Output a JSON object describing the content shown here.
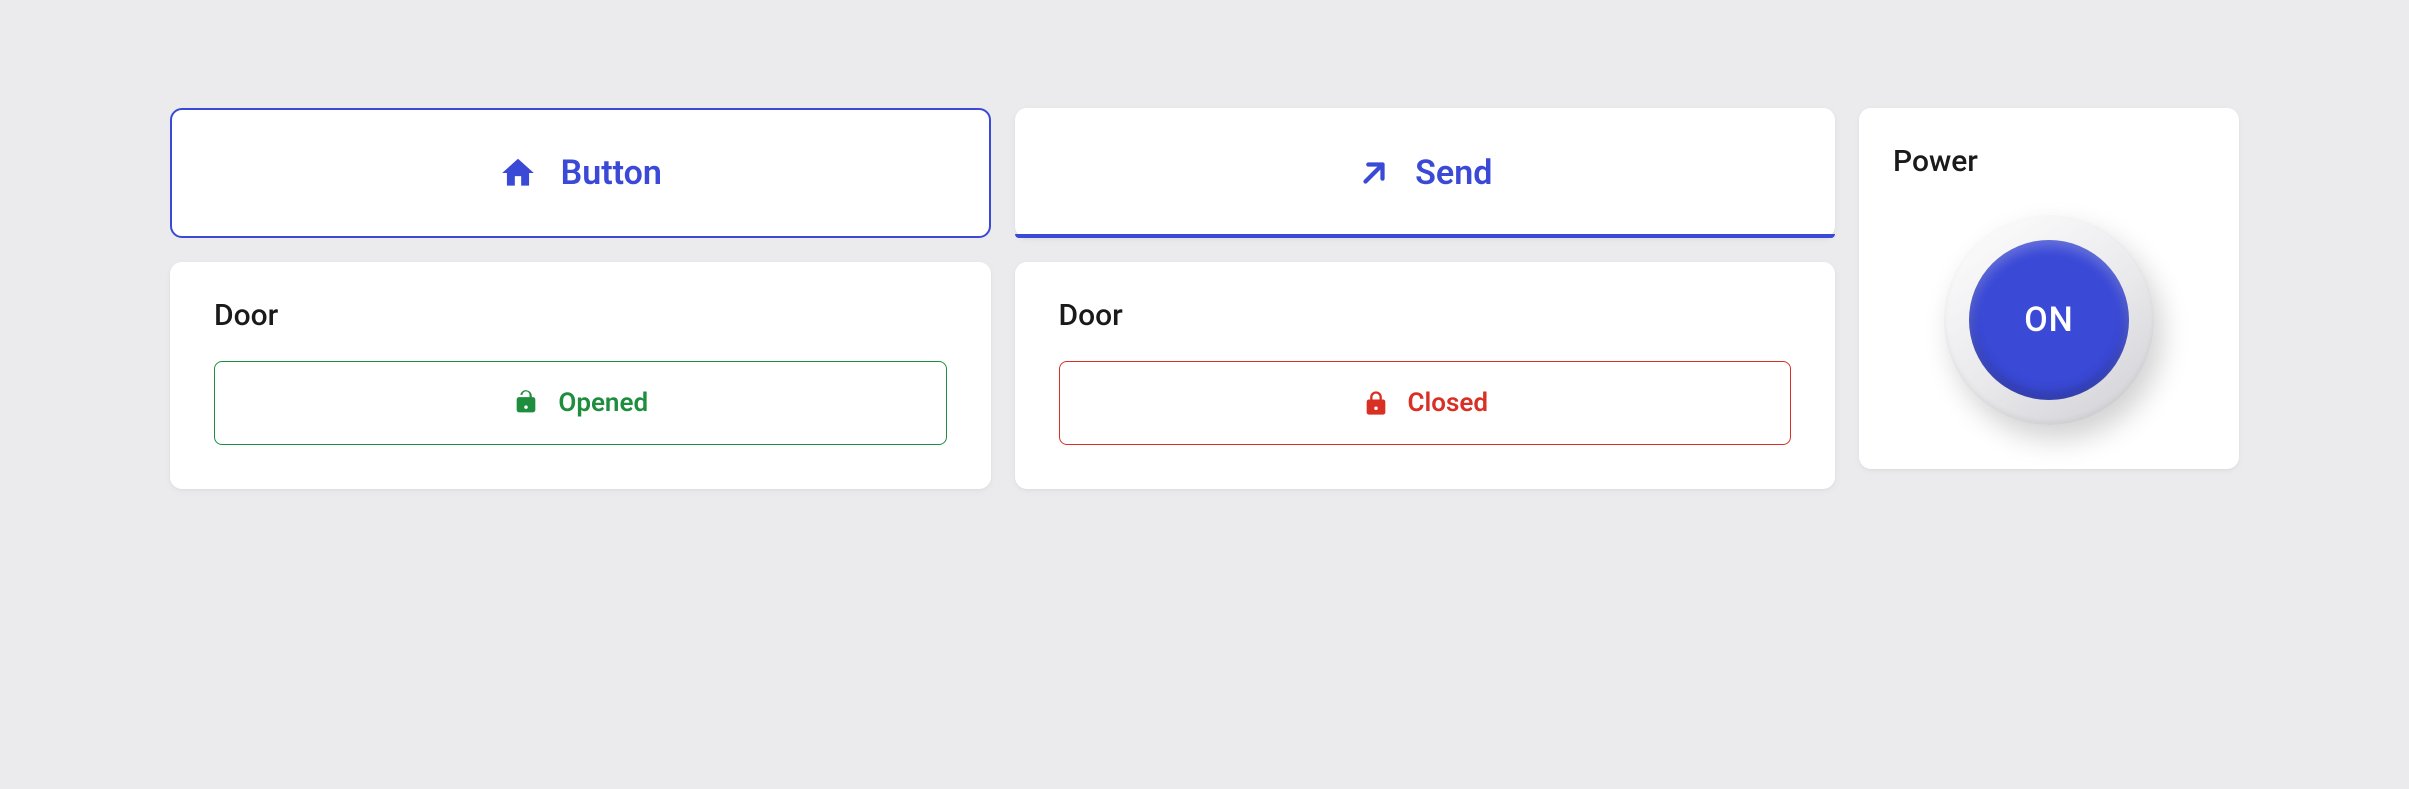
{
  "colors": {
    "accent": "#3a49d6",
    "success": "#1e8e3e",
    "danger": "#d93025",
    "text": "#1a1a1a",
    "bg": "#ebebed",
    "card": "#ffffff"
  },
  "buttons": {
    "home": {
      "label": "Button",
      "icon": "home-icon"
    },
    "send": {
      "label": "Send",
      "icon": "arrow-up-right-icon"
    }
  },
  "doors": [
    {
      "title": "Door",
      "state_label": "Opened",
      "state": "opened",
      "icon": "lock-open-icon"
    },
    {
      "title": "Door",
      "state_label": "Closed",
      "state": "closed",
      "icon": "lock-closed-icon"
    }
  ],
  "power": {
    "title": "Power",
    "state_label": "ON"
  }
}
